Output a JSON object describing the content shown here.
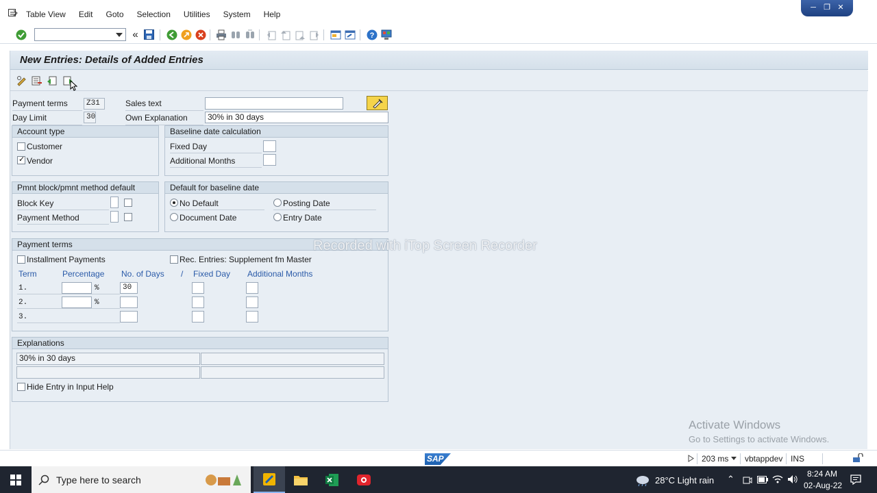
{
  "menu": {
    "items": [
      {
        "label": "Table View",
        "name": "menu-table-view"
      },
      {
        "label": "Edit",
        "name": "menu-edit"
      },
      {
        "label": "Goto",
        "name": "menu-goto"
      },
      {
        "label": "Selection",
        "name": "menu-selection"
      },
      {
        "label": "Utilities",
        "name": "menu-utilities"
      },
      {
        "label": "System",
        "name": "menu-system"
      },
      {
        "label": "Help",
        "name": "menu-help"
      }
    ]
  },
  "toolbar": {
    "command_value": "",
    "back_glyph": "«"
  },
  "page": {
    "title": "New Entries: Details of Added Entries"
  },
  "header": {
    "payment_terms_label": "Payment terms",
    "payment_terms_value": "Z31",
    "sales_text_label": "Sales text",
    "sales_text_value": "",
    "day_limit_label": "Day Limit",
    "day_limit_value": "30",
    "own_explanation_label": "Own Explanation",
    "own_explanation_value": "30% in 30 days"
  },
  "account_type": {
    "title": "Account type",
    "customer_label": "Customer",
    "customer_checked": false,
    "vendor_label": "Vendor",
    "vendor_checked": true
  },
  "baseline_calc": {
    "title": "Baseline date calculation",
    "fixed_day_label": "Fixed Day",
    "fixed_day_value": "",
    "additional_months_label": "Additional Months",
    "additional_months_value": ""
  },
  "pmnt_block": {
    "title": "Pmnt block/pmnt method default",
    "block_key_label": "Block Key",
    "payment_method_label": "Payment Method"
  },
  "default_baseline": {
    "title": "Default for baseline date",
    "options": [
      {
        "label": "No Default",
        "checked": true
      },
      {
        "label": "Posting Date",
        "checked": false
      },
      {
        "label": "Document Date",
        "checked": false
      },
      {
        "label": "Entry Date",
        "checked": false
      }
    ]
  },
  "payment_terms_group": {
    "title": "Payment terms",
    "installment_label": "Installment Payments",
    "rec_entries_label": "Rec. Entries: Supplement fm Master",
    "col_term": "Term",
    "col_percentage": "Percentage",
    "col_no_days": "No. of Days",
    "col_slash": "/",
    "col_fixed_day": "Fixed Day",
    "col_additional_months": "Additional Months",
    "percent_sign": "%",
    "rows": [
      {
        "term": "1.",
        "percentage": "",
        "days": "30"
      },
      {
        "term": "2.",
        "percentage": "",
        "days": ""
      },
      {
        "term": "3.",
        "days": ""
      }
    ]
  },
  "explanations": {
    "title": "Explanations",
    "line1": "30% in 30 days",
    "line1b": "",
    "line2": "",
    "line2b": "",
    "hide_label": "Hide Entry in Input Help"
  },
  "overlay": {
    "watermark": "Recorded with iTop Screen Recorder",
    "activate_title": "Activate Windows",
    "activate_sub": "Go to Settings to activate Windows."
  },
  "status": {
    "sap_logo": "SAP",
    "response_time": "203 ms",
    "server": "vbtappdev",
    "mode": "INS"
  },
  "taskbar": {
    "search_placeholder": "Type here to search",
    "weather": "28°C  Light rain",
    "time": "8:24 AM",
    "date": "02-Aug-22"
  },
  "colors": {
    "accent": "#2a5aa8",
    "background": "#e8eef4",
    "taskbar": "#1f2530"
  }
}
